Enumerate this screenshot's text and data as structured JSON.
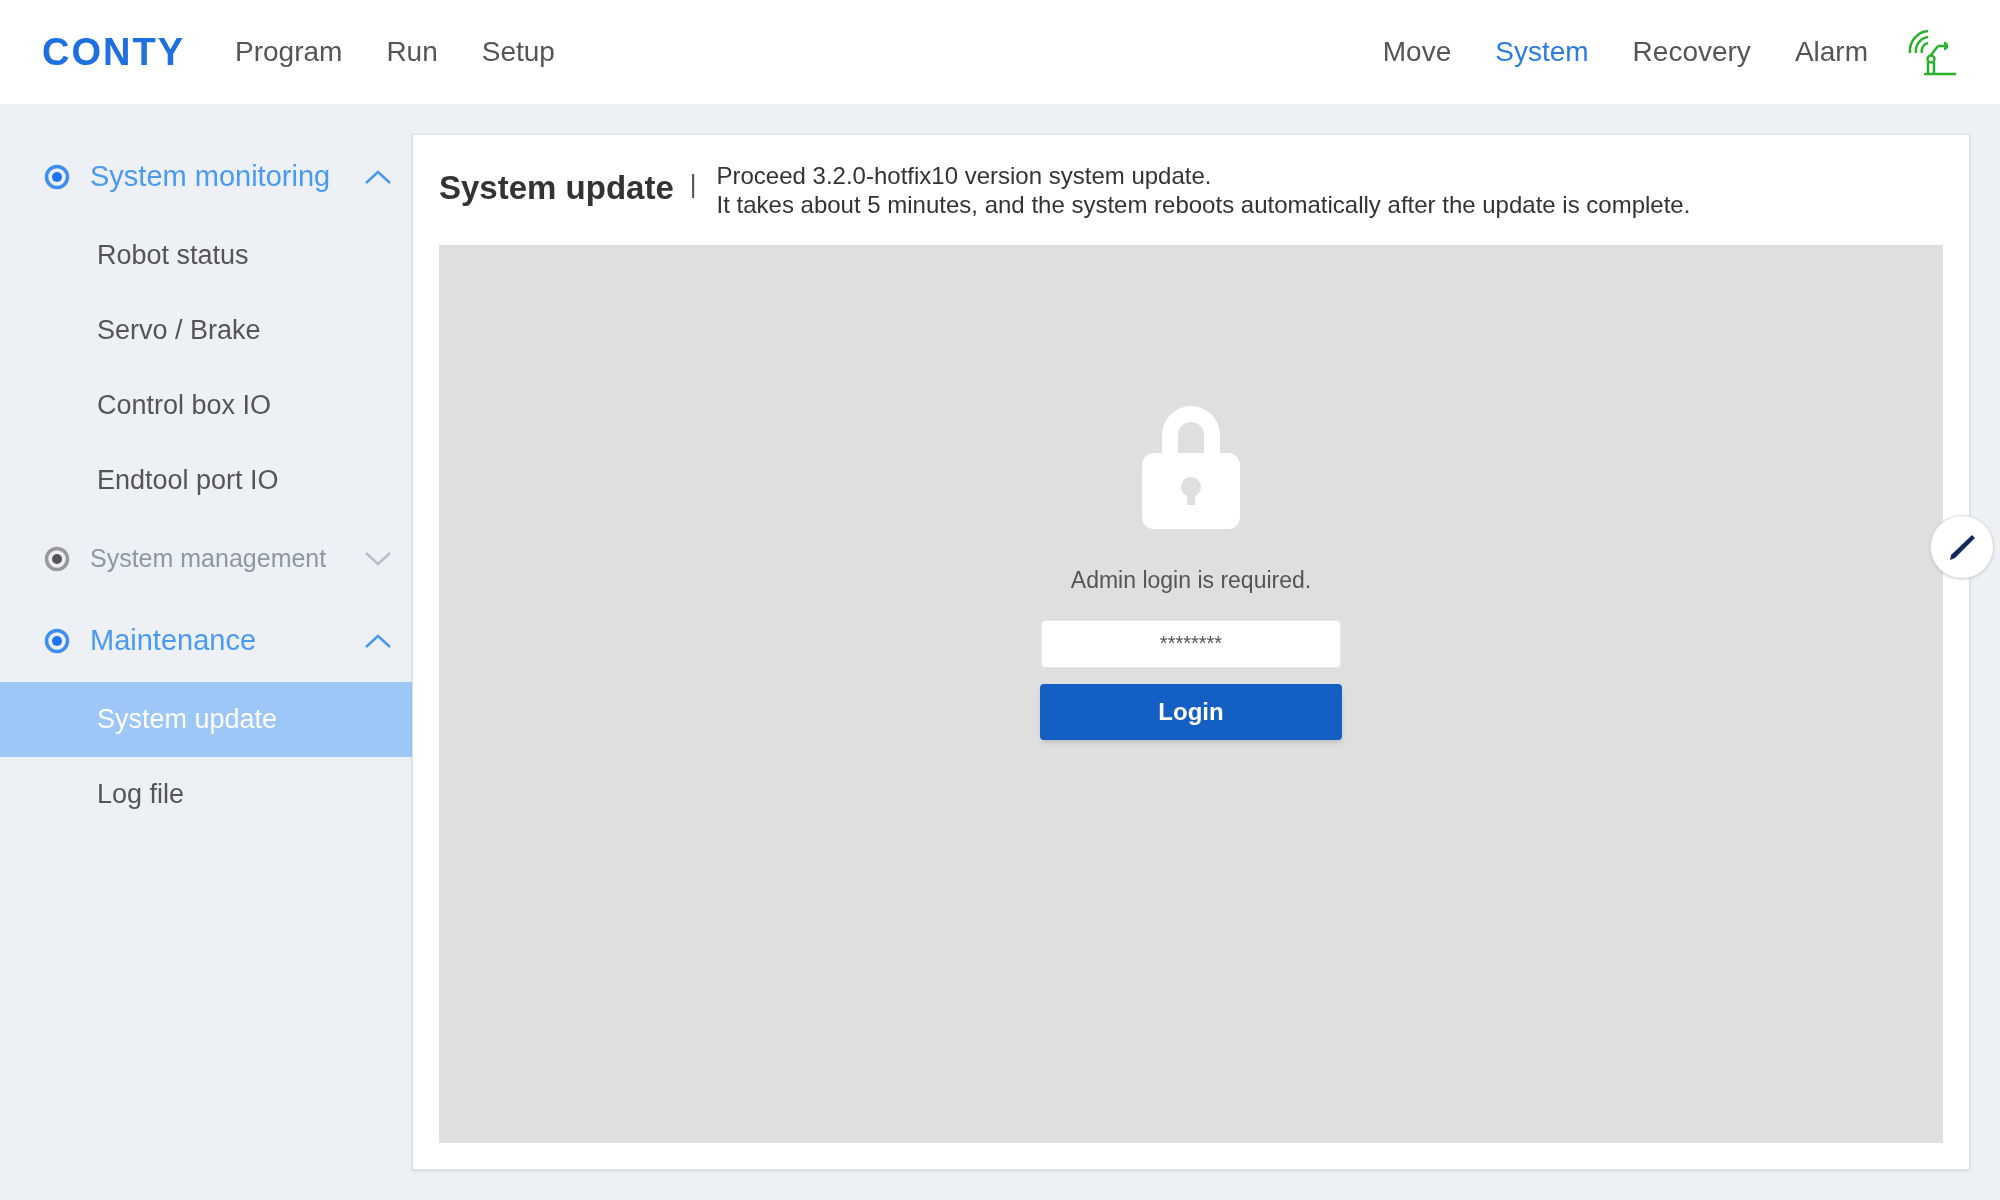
{
  "header": {
    "logo": "CONTY",
    "nav_left": [
      {
        "label": "Program",
        "selected": false
      },
      {
        "label": "Run",
        "selected": false
      },
      {
        "label": "Setup",
        "selected": false
      }
    ],
    "nav_right": [
      {
        "label": "Move",
        "selected": false
      },
      {
        "label": "System",
        "selected": true
      },
      {
        "label": "Recovery",
        "selected": false
      },
      {
        "label": "Alarm",
        "selected": false
      }
    ]
  },
  "sidebar": {
    "groups": [
      {
        "label": "System monitoring",
        "expanded": true,
        "items": [
          {
            "label": "Robot status",
            "selected": false
          },
          {
            "label": "Servo / Brake",
            "selected": false
          },
          {
            "label": "Control box IO",
            "selected": false
          },
          {
            "label": "Endtool port IO",
            "selected": false
          }
        ]
      },
      {
        "label": "System management",
        "expanded": false
      },
      {
        "label": "Maintenance",
        "expanded": true,
        "items": [
          {
            "label": "System update",
            "selected": true
          },
          {
            "label": "Log file",
            "selected": false
          }
        ]
      }
    ]
  },
  "content": {
    "title": "System update",
    "separator": "|",
    "description": [
      "Proceed 3.2.0-hotfix10 version system update.",
      "It takes about 5 minutes, and the system reboots automatically after the update is complete."
    ],
    "login": {
      "message": "Admin login is required.",
      "password": {
        "value": "********"
      },
      "button": "Login"
    }
  }
}
